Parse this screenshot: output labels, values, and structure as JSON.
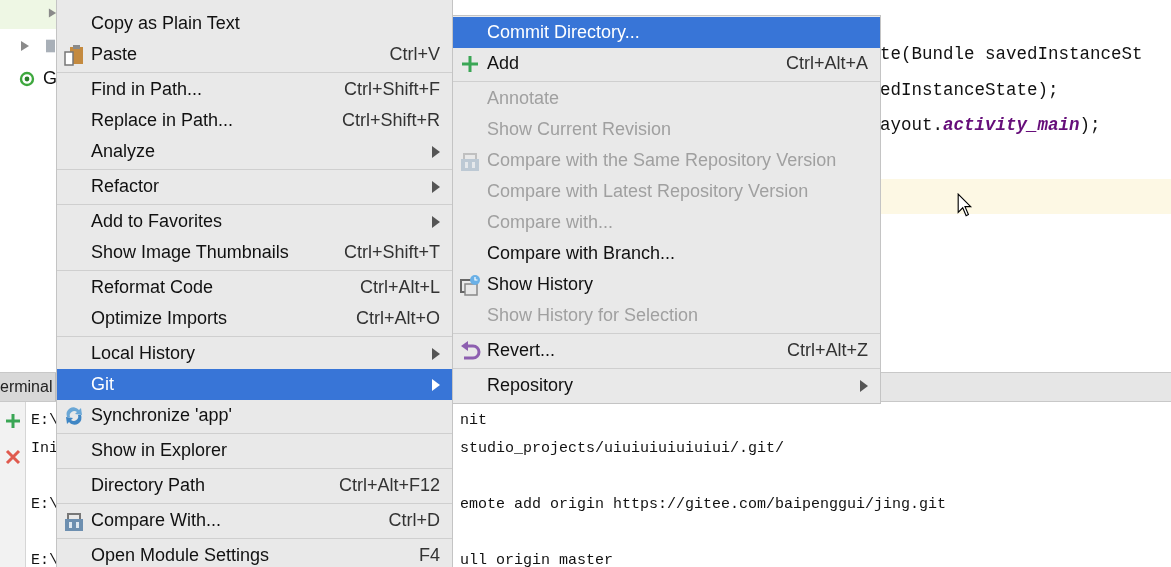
{
  "project_tree": {
    "rows": [
      {
        "selected": true,
        "expandable": true
      },
      {
        "selected": false,
        "expandable": true
      },
      {
        "selected": false,
        "expandable": false,
        "label": "G"
      }
    ]
  },
  "editor": {
    "lines": [
      {
        "current": false
      },
      {
        "current": false,
        "text": "te(Bundle savedInstanceSt"
      },
      {
        "current": false,
        "text": "edInstanceState);"
      },
      {
        "current": false,
        "text": "ayout.*activity_main*);"
      },
      {
        "current": false
      },
      {
        "current": true
      },
      {
        "current": false
      }
    ]
  },
  "tool_window": {
    "tab": "erminal"
  },
  "terminal": {
    "blocks": [
      {
        "lines": [
          {
            "left": "E:\\",
            "right": "nit"
          },
          {
            "left": "Ini",
            "right": "studio_projects/uiuiuiuiuiuiui/.git/"
          }
        ]
      },
      {
        "lines": [
          {
            "left": "E:\\",
            "right": "emote add origin https://gitee.com/baipenggui/jing.git"
          }
        ]
      },
      {
        "lines": [
          {
            "left": "E:\\",
            "right": "ull origin master"
          }
        ]
      }
    ]
  },
  "context_menu": {
    "sections": [
      {
        "items": [
          {
            "label": "Copy as Plain Text",
            "selected": false,
            "submenu": false
          },
          {
            "label": "Paste",
            "shortcut": "Ctrl+V",
            "selected": false,
            "submenu": false
          }
        ]
      },
      {
        "items": [
          {
            "label": "Find in Path...",
            "shortcut": "Ctrl+Shift+F",
            "selected": false,
            "submenu": false
          },
          {
            "label": "Replace in Path...",
            "shortcut": "Ctrl+Shift+R",
            "selected": false,
            "submenu": false
          },
          {
            "label": "Analyze",
            "selected": false,
            "submenu": true
          }
        ]
      },
      {
        "items": [
          {
            "label": "Refactor",
            "selected": false,
            "submenu": true
          }
        ]
      },
      {
        "items": [
          {
            "label": "Add to Favorites",
            "selected": false,
            "submenu": true
          },
          {
            "label": "Show Image Thumbnails",
            "shortcut": "Ctrl+Shift+T",
            "selected": false,
            "submenu": false
          }
        ]
      },
      {
        "items": [
          {
            "label": "Reformat Code",
            "shortcut": "Ctrl+Alt+L",
            "selected": false,
            "submenu": false
          },
          {
            "label": "Optimize Imports",
            "shortcut": "Ctrl+Alt+O",
            "selected": false,
            "submenu": false
          }
        ]
      },
      {
        "items": [
          {
            "label": "Local History",
            "selected": false,
            "submenu": true
          },
          {
            "label": "Git",
            "selected": true,
            "submenu": true
          },
          {
            "label": "Synchronize 'app'",
            "selected": false,
            "submenu": false
          }
        ]
      },
      {
        "items": [
          {
            "label": "Show in Explorer",
            "selected": false,
            "submenu": false
          }
        ]
      },
      {
        "items": [
          {
            "label": "Directory Path",
            "shortcut": "Ctrl+Alt+F12",
            "selected": false,
            "submenu": false
          }
        ]
      },
      {
        "items": [
          {
            "label": "Compare With...",
            "shortcut": "Ctrl+D",
            "selected": false,
            "submenu": false
          }
        ]
      },
      {
        "items": [
          {
            "label": "Open Module Settings",
            "shortcut": "F4",
            "selected": false,
            "submenu": false
          }
        ]
      }
    ]
  },
  "git_submenu": {
    "sections": [
      {
        "items": [
          {
            "label": "Commit Directory...",
            "selected": true,
            "disabled": false,
            "submenu": false
          },
          {
            "label": "Add",
            "shortcut": "Ctrl+Alt+A",
            "selected": false,
            "disabled": false,
            "submenu": false
          }
        ]
      },
      {
        "items": [
          {
            "label": "Annotate",
            "selected": false,
            "disabled": true,
            "submenu": false
          },
          {
            "label": "Show Current Revision",
            "selected": false,
            "disabled": true,
            "submenu": false
          },
          {
            "label": "Compare with the Same Repository Version",
            "selected": false,
            "disabled": true,
            "submenu": false
          },
          {
            "label": "Compare with Latest Repository Version",
            "selected": false,
            "disabled": true,
            "submenu": false
          },
          {
            "label": "Compare with...",
            "selected": false,
            "disabled": true,
            "submenu": false
          },
          {
            "label": "Compare with Branch...",
            "selected": false,
            "disabled": false,
            "submenu": false
          },
          {
            "label": "Show History",
            "selected": false,
            "disabled": false,
            "submenu": false
          },
          {
            "label": "Show History for Selection",
            "selected": false,
            "disabled": true,
            "submenu": false
          }
        ]
      },
      {
        "items": [
          {
            "label": "Revert...",
            "shortcut": "Ctrl+Alt+Z",
            "selected": false,
            "disabled": false,
            "submenu": false
          }
        ]
      },
      {
        "items": [
          {
            "label": "Repository",
            "selected": false,
            "disabled": false,
            "submenu": true
          }
        ]
      }
    ]
  }
}
